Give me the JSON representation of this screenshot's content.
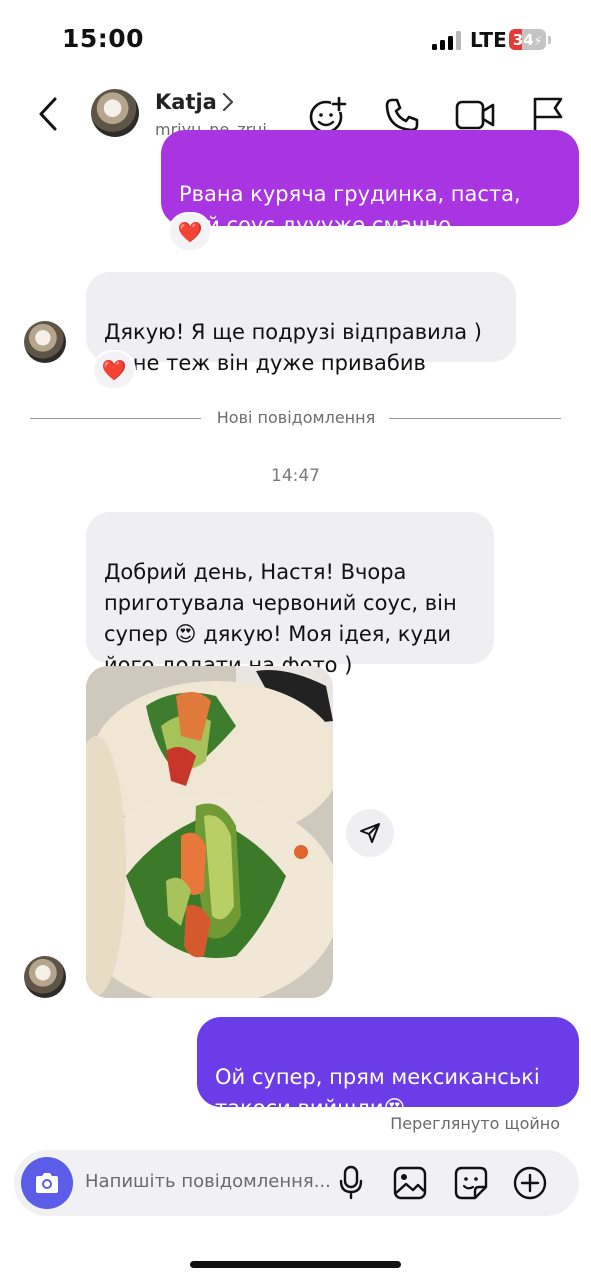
{
  "status_bar": {
    "time": "15:00",
    "network": "LTE",
    "battery": "34",
    "battery_level_percent": 34,
    "signal_bars_active": 3
  },
  "header": {
    "contact_name": "Katja",
    "username": "mriyu_ne_zrui...",
    "icons": [
      "back-icon",
      "chevron-right-icon",
      "emoji-add-icon",
      "phone-icon",
      "video-call-icon",
      "flag-icon"
    ]
  },
  "messages": {
    "msg1_text": "Рвана куряча грудинка, паста,\nцей соус дуууже смачно",
    "msg1_reaction": "❤️",
    "msg2_text": "Дякую! Я ще подрузі відправила )\nмене теж він дуже привабив",
    "msg2_reaction": "❤️",
    "new_messages_label": "Нові повідомлення",
    "timestamp": "14:47",
    "msg3_text": "Добрий день, Настя! Вчора\nприготувала червоний соус, він\nсупер 😍 дякую! Моя ідея, куди\nйого додати на фото )",
    "msg4_text": "Ой супер, прям мексиканські\nтакоси вийшли😍",
    "seen_label": "Переглянуто щойно"
  },
  "composer": {
    "placeholder": "Напишіть повідомлення..."
  },
  "colors": {
    "purple_bubble": "#a835e1",
    "blue_bubble": "#6a3de8",
    "incoming_bubble": "#efeff1",
    "camera_button": "#5b5ce8",
    "battery_low": "#e23b3b"
  }
}
